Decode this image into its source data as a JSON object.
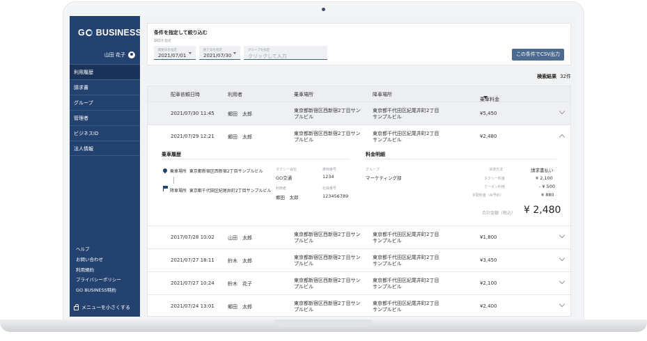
{
  "sidebar": {
    "logo": "GO BUSINESS",
    "user_name": "山田 花子",
    "nav": [
      "利用履歴",
      "請求書",
      "グループ",
      "管理者",
      "ビジネスID",
      "法人情報"
    ],
    "footer_links": [
      "ヘルプ",
      "お問い合わせ",
      "利用規約",
      "プライバシーポリシー",
      "GO BUSINESS特約"
    ],
    "collapse_label": "メニューを小さくする"
  },
  "filter": {
    "title": "条件を指定して絞り込む",
    "period_label": "期間を指定",
    "start": {
      "placeholder": "開始日を指定",
      "value": "2021/07/01"
    },
    "end": {
      "placeholder": "終了日を指定",
      "value": "2021/07/30"
    },
    "group": {
      "placeholder": "グループを指定",
      "value": "クリックして入力"
    },
    "csv_button": "この条件でCSV出力"
  },
  "result": {
    "label": "検索結果",
    "count": "32件"
  },
  "table": {
    "headers": [
      "配車依頼日時",
      "利用者",
      "乗車場所",
      "降車場所",
      "乗車料金"
    ],
    "rows": [
      {
        "datetime": "2021/07/30 11:45",
        "user": "郷田　太郎",
        "pickup": "東京都新宿区西新宿2丁目サンプルビル",
        "dropoff": "東京都千代田区紀尾井町2丁目サンプルビル",
        "fare": "¥5,450"
      },
      {
        "datetime": "2021/07/29 12:21",
        "user": "郷田　太郎",
        "pickup": "東京都新宿区西新宿2丁目サンプルビル",
        "dropoff": "東京都千代田区紀尾井町2丁目サンプルビル",
        "fare": "¥2,480"
      },
      {
        "datetime": "2017/07/28 10:02",
        "user": "山田　太郎",
        "pickup": "東京都新宿区西新宿2丁目サンプルビル",
        "dropoff": "東京都千代田区紀尾井町2丁目サンプルビル",
        "fare": "¥1,800"
      },
      {
        "datetime": "2021/07/27 18:11",
        "user": "鈴木　太郎",
        "pickup": "東京都新宿区西新宿2丁目サンプルビル",
        "dropoff": "東京都千代田区紀尾井町2丁目サンプルビル",
        "fare": "¥3,450"
      },
      {
        "datetime": "2021/07/27 10:24",
        "user": "鈴木　花子",
        "pickup": "東京都新宿区西新宿2丁目サンプルビル",
        "dropoff": "東京都千代田区紀尾井町2丁目サンプルビル",
        "fare": "¥2,100"
      },
      {
        "datetime": "2021/07/24 13:01",
        "user": "郷田　太郎",
        "pickup": "東京都新宿区西新宿2丁目サンプルビル",
        "dropoff": "東京都千代田区紀尾井町2丁目サンプルビル",
        "fare": "¥2,400"
      }
    ]
  },
  "detail": {
    "ride_title": "乗車履歴",
    "pickup_tag": "乗車場所",
    "pickup": "東京都新宿区西新宿2丁目サンプルビル",
    "dropoff_tag": "降車場所",
    "dropoff": "東京都千代田区紀尾井町2丁目サンプルビル",
    "taxi_company_label": "タクシー会社",
    "taxi_company": "GO交通",
    "car_number_label": "車両番号",
    "car_number": "1234",
    "user_label": "利用者",
    "user": "郷田　太郎",
    "employee_no_label": "社員番号",
    "employee_no": "123456789",
    "fare_title": "料金明細",
    "group_label": "グループ",
    "group": "マーケティング部",
    "payment_label": "決済方法",
    "payment": "請求書払い",
    "taxi_fare_label": "タクシー料金",
    "taxi_fare": "¥ 2,100",
    "coupon_label": "クーポン利用",
    "coupon": "- ¥ 500",
    "booking_fee_label": "手配料金（AI予約）",
    "booking_fee": "¥ 880",
    "total_label": "合計金額（税込）",
    "total": "¥ 2,480"
  },
  "colors": {
    "sidebar": "#24426f",
    "button": "#4c6b8e",
    "header_row": "#eceef1"
  }
}
